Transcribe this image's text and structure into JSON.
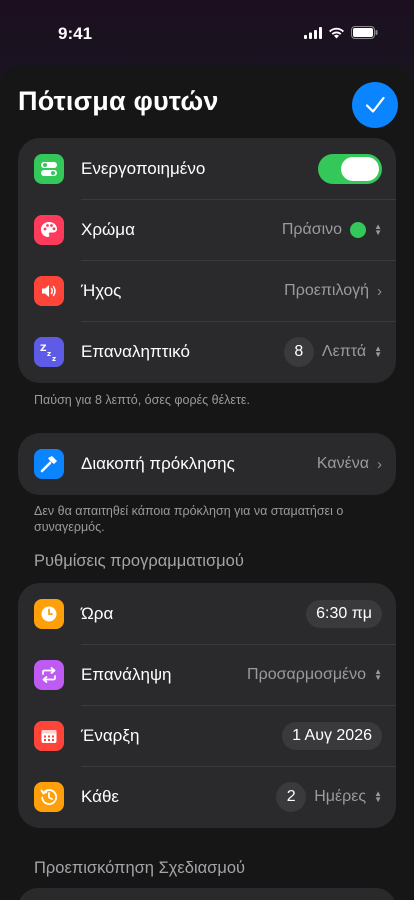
{
  "status": {
    "time": "9:41"
  },
  "header": {
    "title": "Πότισμα φυτών"
  },
  "card1": {
    "enabled": {
      "label": "Ενεργοποιημένο",
      "on": true
    },
    "color": {
      "label": "Χρώμα",
      "value": "Πράσινο",
      "swatch": "#34c759"
    },
    "sound": {
      "label": "Ήχος",
      "value": "Προεπιλογή"
    },
    "repeat": {
      "label": "Επαναληπτικό",
      "count": "8",
      "unit": "Λεπτά"
    }
  },
  "card1_footnote": "Παύση για 8 λεπτό, όσες φορές θέλετε.",
  "card2": {
    "challenge": {
      "label": "Διακοπή πρόκλησης",
      "value": "Κανένα"
    }
  },
  "card2_footnote": "Δεν θα απαιτηθεί κάποια πρόκληση για να σταματήσει ο συναγερμός.",
  "schedule": {
    "header": "Ρυθμίσεις προγραμματισμού",
    "time": {
      "label": "Ώρα",
      "value": "6:30 πμ"
    },
    "repeat": {
      "label": "Επανάληψη",
      "value": "Προσαρμοσμένο"
    },
    "start": {
      "label": "Έναρξη",
      "value": "1 Αυγ 2026"
    },
    "every": {
      "label": "Κάθε",
      "count": "2",
      "unit": "Ημέρες"
    }
  },
  "preview": {
    "header": "Προεπισκόπηση Σχεδιασμού"
  },
  "colors": {
    "accent": "#0a84ff",
    "green": "#34c759",
    "palette_icon": "#ff3b5c",
    "sound_icon": "#ff453a",
    "snooze_icon": "#5e5ce6",
    "challenge_icon": "#0a84ff",
    "clock_icon": "#ff9f0a",
    "repeat_icon": "#bf5af2",
    "calendar_icon": "#ff453a",
    "history_icon": "#ff9f0a"
  },
  "icons": [
    "toggle-icon",
    "palette-icon",
    "speaker-icon",
    "zzz-icon",
    "hammer-icon",
    "clock-icon",
    "repeat-icon",
    "calendar-icon",
    "history-icon",
    "checkmark-icon",
    "signal-icon",
    "wifi-icon",
    "battery-icon"
  ]
}
